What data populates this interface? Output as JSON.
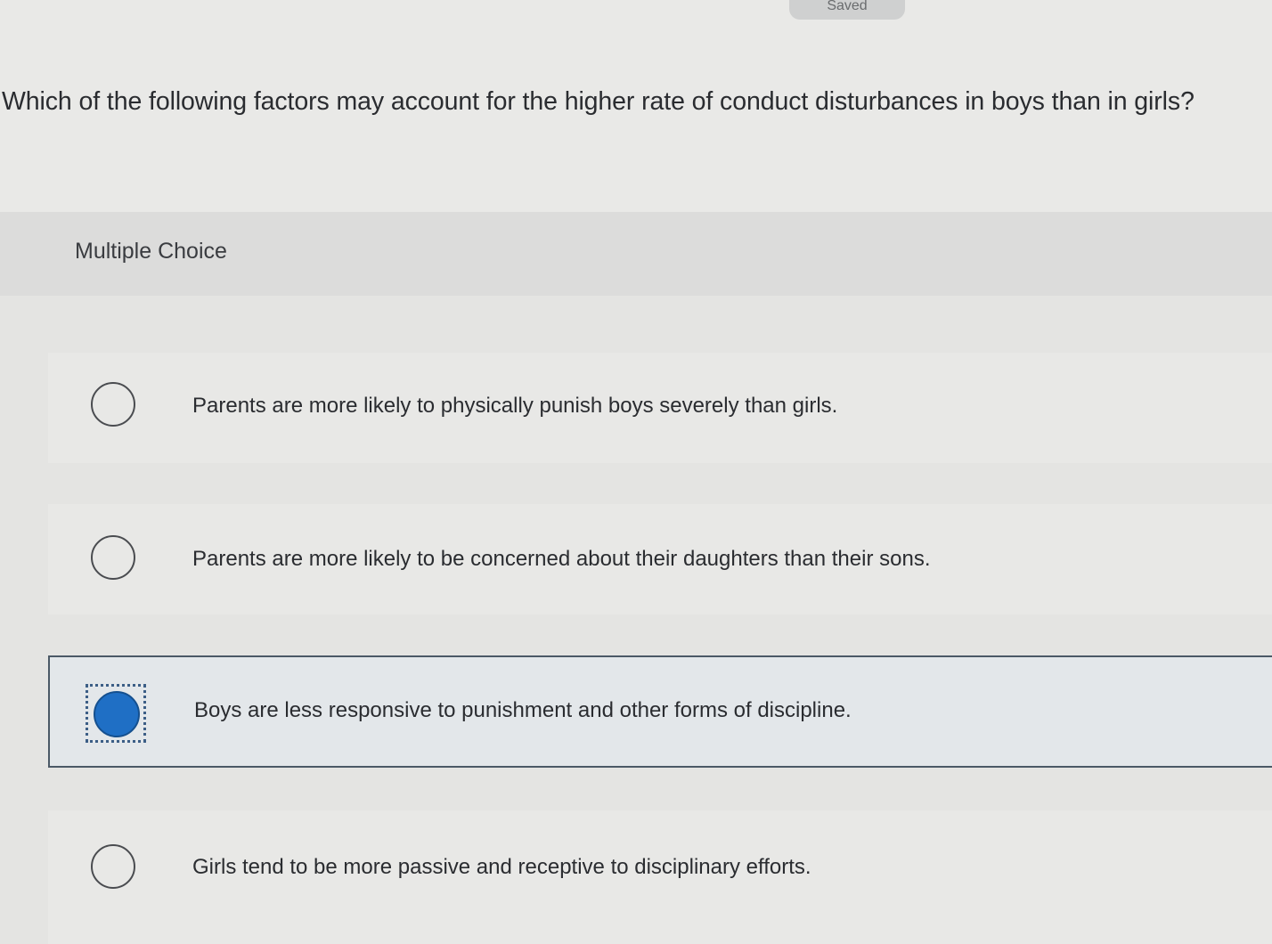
{
  "header": {
    "saved_label": "Saved"
  },
  "question": {
    "text": "Which of the following factors may account for the higher rate of conduct disturbances in boys than in girls?"
  },
  "section": {
    "label": "Multiple Choice"
  },
  "choices": [
    {
      "text": "Parents are more likely to physically punish boys severely than girls.",
      "selected": false
    },
    {
      "text": "Parents are more likely to be concerned about their daughters than their sons.",
      "selected": false
    },
    {
      "text": "Boys are less responsive to punishment and other forms of discipline.",
      "selected": true
    },
    {
      "text": "Girls tend to be more passive and receptive to disciplinary efforts.",
      "selected": false
    }
  ],
  "colors": {
    "selected_radio": "#1f6fc5",
    "selected_border": "#4b5966",
    "background": "#e6e6e4"
  }
}
